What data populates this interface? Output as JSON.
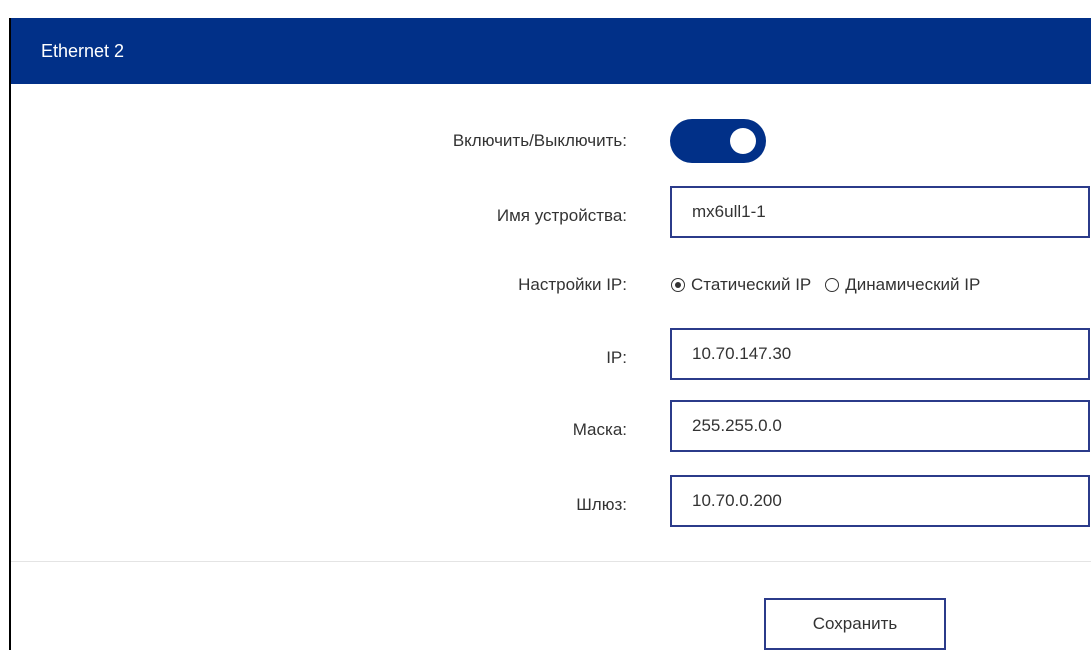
{
  "header": {
    "title": "Ethernet 2"
  },
  "form": {
    "enable_label": "Включить/Выключить:",
    "enabled": true,
    "device_name_label": "Имя устройства:",
    "device_name_value": "mx6ull1-1",
    "ip_settings_label": "Настройки IP:",
    "ip_mode_options": [
      "Статический IP",
      "Динамический IP"
    ],
    "ip_mode_selected": "Статический IP",
    "ip_label": "IP:",
    "ip_value": "10.70.147.30",
    "mask_label": "Маска:",
    "mask_value": "255.255.0.0",
    "gateway_label": "Шлюз:",
    "gateway_value": "10.70.0.200"
  },
  "footer": {
    "save_label": "Сохранить"
  },
  "colors": {
    "header_bg": "#013088",
    "accent": "#013088",
    "field_border": "#2b3b8a"
  }
}
